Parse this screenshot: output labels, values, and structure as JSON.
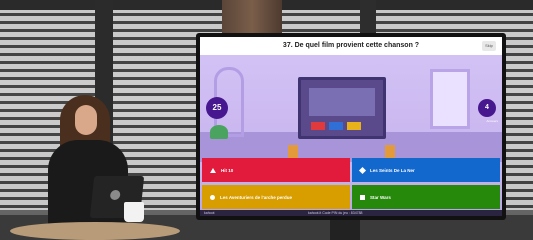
{
  "kahoot": {
    "question": "37. De quel film provient cette chanson ?",
    "skip_label": "Skip",
    "timer": "25",
    "answer_count": "4",
    "answer_count_label": "Answers",
    "answers": [
      {
        "label": "Hit 10",
        "color": "#e21b3c",
        "shape": "triangle"
      },
      {
        "label": "Les Seints De La Ner",
        "color": "#1368ce",
        "shape": "diamond"
      },
      {
        "label": "Les Aventuriers de l'arche perdue",
        "color": "#d89e00",
        "shape": "circle"
      },
      {
        "label": "Star Wars",
        "color": "#26890c",
        "shape": "square"
      }
    ],
    "footer_left": "kahoot",
    "footer_pin": "kahoot.it   Code PIN du jeu : 834788"
  }
}
